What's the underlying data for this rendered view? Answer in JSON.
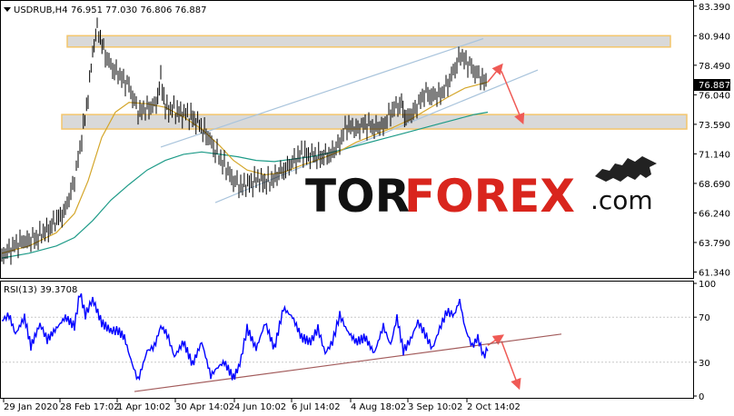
{
  "main_header": {
    "symbol": "USDRUB,H4",
    "ohlc": "76.951 77.030 76.806 76.887"
  },
  "rsi_header": "RSI(13) 39.3708",
  "watermark": {
    "part1": "TOR",
    "part2": "FOREX",
    "suffix": ".com",
    "logo": "bull-icon"
  },
  "colors": {
    "candle": "#000000",
    "ma_fast": "#d4a62a",
    "ma_slow": "#1e9b88",
    "channel": "#a9c4dc",
    "zone_fill": "#d9d9d9",
    "zone_border": "#f3c56b",
    "arrow": "#ef5a55",
    "rsi_line": "#0000ff",
    "rsi_trend": "#a35c5c",
    "price_label_bg": "#000000"
  },
  "chart_data": [
    {
      "type": "candlestick",
      "title": "USDRUB,H4",
      "y_ticks": [
        "83.390",
        "80.940",
        "78.490",
        "76.040",
        "73.590",
        "71.140",
        "68.690",
        "66.240",
        "63.790",
        "61.340"
      ],
      "ylim": [
        61.0,
        83.6
      ],
      "current_price": "76.887",
      "x_labels": [
        "29 Jan 2020",
        "28 Feb 17:02",
        "1 Apr 10:02",
        "30 Apr 14:02",
        "4 Jun 10:02",
        "6 Jul 14:02",
        "4 Aug 18:02",
        "3 Sep 10:02",
        "2 Oct 14:02"
      ],
      "price_path": [
        [
          0,
          62.7
        ],
        [
          20,
          63.8
        ],
        [
          40,
          64.2
        ],
        [
          55,
          65.2
        ],
        [
          70,
          66.5
        ],
        [
          80,
          69.0
        ],
        [
          88,
          72.5
        ],
        [
          95,
          75.8
        ],
        [
          100,
          79.5
        ],
        [
          105,
          81.5
        ],
        [
          112,
          79.8
        ],
        [
          120,
          78.4
        ],
        [
          130,
          77.6
        ],
        [
          140,
          76.8
        ],
        [
          150,
          74.6
        ],
        [
          160,
          74.9
        ],
        [
          170,
          75.3
        ],
        [
          175,
          77.5
        ],
        [
          180,
          75.0
        ],
        [
          195,
          74.6
        ],
        [
          210,
          74.2
        ],
        [
          225,
          72.8
        ],
        [
          235,
          71.4
        ],
        [
          245,
          70.2
        ],
        [
          255,
          68.9
        ],
        [
          265,
          68.4
        ],
        [
          280,
          69.0
        ],
        [
          295,
          68.8
        ],
        [
          305,
          69.5
        ],
        [
          320,
          70.4
        ],
        [
          330,
          71.2
        ],
        [
          345,
          70.9
        ],
        [
          360,
          71.0
        ],
        [
          370,
          71.8
        ],
        [
          380,
          73.5
        ],
        [
          390,
          73.2
        ],
        [
          400,
          73.6
        ],
        [
          410,
          73.3
        ],
        [
          420,
          73.5
        ],
        [
          430,
          74.8
        ],
        [
          440,
          75.3
        ],
        [
          445,
          74.0
        ],
        [
          455,
          74.8
        ],
        [
          465,
          76.2
        ],
        [
          475,
          75.9
        ],
        [
          485,
          76.2
        ],
        [
          495,
          77.6
        ],
        [
          505,
          79.3
        ],
        [
          515,
          78.5
        ],
        [
          525,
          77.6
        ],
        [
          535,
          76.9
        ]
      ],
      "ma_fast_path": [
        [
          0,
          62.9
        ],
        [
          30,
          63.5
        ],
        [
          60,
          64.6
        ],
        [
          80,
          66.2
        ],
        [
          95,
          68.9
        ],
        [
          110,
          72.5
        ],
        [
          125,
          74.6
        ],
        [
          140,
          75.4
        ],
        [
          160,
          75.3
        ],
        [
          180,
          75.0
        ],
        [
          200,
          74.2
        ],
        [
          220,
          73.2
        ],
        [
          240,
          71.8
        ],
        [
          255,
          70.6
        ],
        [
          270,
          69.8
        ],
        [
          290,
          69.4
        ],
        [
          310,
          69.6
        ],
        [
          330,
          70.2
        ],
        [
          350,
          70.7
        ],
        [
          370,
          71.3
        ],
        [
          390,
          72.1
        ],
        [
          410,
          72.7
        ],
        [
          430,
          73.3
        ],
        [
          450,
          74.0
        ],
        [
          470,
          74.9
        ],
        [
          490,
          75.8
        ],
        [
          510,
          76.6
        ],
        [
          535,
          77.1
        ]
      ],
      "ma_slow_path": [
        [
          0,
          62.5
        ],
        [
          30,
          62.9
        ],
        [
          60,
          63.5
        ],
        [
          80,
          64.2
        ],
        [
          100,
          65.6
        ],
        [
          120,
          67.3
        ],
        [
          140,
          68.6
        ],
        [
          160,
          69.8
        ],
        [
          180,
          70.6
        ],
        [
          200,
          71.1
        ],
        [
          220,
          71.3
        ],
        [
          240,
          71.1
        ],
        [
          260,
          70.9
        ],
        [
          280,
          70.6
        ],
        [
          300,
          70.5
        ],
        [
          320,
          70.7
        ],
        [
          340,
          70.9
        ],
        [
          360,
          71.2
        ],
        [
          380,
          71.6
        ],
        [
          400,
          72.0
        ],
        [
          420,
          72.4
        ],
        [
          440,
          72.8
        ],
        [
          460,
          73.2
        ],
        [
          480,
          73.6
        ],
        [
          500,
          74.0
        ],
        [
          520,
          74.4
        ],
        [
          535,
          74.6
        ]
      ],
      "resistance_zone": [
        80.0,
        80.94
      ],
      "support_zone": [
        73.2,
        74.4
      ],
      "channel_lower": [
        [
          237,
          67.1
        ],
        [
          592,
          78.1
        ]
      ],
      "channel_upper": [
        [
          177,
          71.7
        ],
        [
          532,
          80.7
        ]
      ],
      "forecast_arrow": [
        [
          535,
          77.1
        ],
        [
          548,
          78.3
        ],
        [
          572,
          74.0
        ]
      ]
    },
    {
      "type": "line",
      "title": "RSI(13) 39.3708",
      "y_ticks": [
        "100",
        "70",
        "30",
        "0"
      ],
      "ylim": [
        0,
        100
      ],
      "rsi_path": [
        [
          0,
          67
        ],
        [
          8,
          72
        ],
        [
          15,
          55
        ],
        [
          25,
          70
        ],
        [
          32,
          44
        ],
        [
          42,
          64
        ],
        [
          50,
          50
        ],
        [
          60,
          60
        ],
        [
          70,
          70
        ],
        [
          80,
          62
        ],
        [
          86,
          92
        ],
        [
          92,
          72
        ],
        [
          100,
          86
        ],
        [
          110,
          65
        ],
        [
          120,
          58
        ],
        [
          128,
          58
        ],
        [
          135,
          52
        ],
        [
          142,
          32
        ],
        [
          150,
          14
        ],
        [
          160,
          40
        ],
        [
          168,
          44
        ],
        [
          175,
          62
        ],
        [
          182,
          55
        ],
        [
          190,
          35
        ],
        [
          200,
          48
        ],
        [
          210,
          28
        ],
        [
          220,
          48
        ],
        [
          230,
          18
        ],
        [
          238,
          26
        ],
        [
          245,
          30
        ],
        [
          255,
          16
        ],
        [
          262,
          28
        ],
        [
          270,
          60
        ],
        [
          280,
          42
        ],
        [
          290,
          65
        ],
        [
          300,
          42
        ],
        [
          310,
          78
        ],
        [
          320,
          70
        ],
        [
          330,
          52
        ],
        [
          340,
          48
        ],
        [
          348,
          60
        ],
        [
          356,
          38
        ],
        [
          364,
          48
        ],
        [
          372,
          72
        ],
        [
          380,
          58
        ],
        [
          390,
          48
        ],
        [
          400,
          52
        ],
        [
          410,
          38
        ],
        [
          420,
          62
        ],
        [
          428,
          45
        ],
        [
          435,
          70
        ],
        [
          442,
          40
        ],
        [
          450,
          50
        ],
        [
          458,
          66
        ],
        [
          466,
          55
        ],
        [
          474,
          42
        ],
        [
          482,
          60
        ],
        [
          490,
          75
        ],
        [
          498,
          72
        ],
        [
          504,
          85
        ],
        [
          510,
          60
        ],
        [
          518,
          44
        ],
        [
          524,
          52
        ],
        [
          530,
          36
        ],
        [
          535,
          40
        ]
      ],
      "rsi_trendline": [
        [
          148,
          4
        ],
        [
          618,
          55
        ]
      ],
      "rsi_arrow": [
        [
          535,
          45
        ],
        [
          548,
          52
        ],
        [
          568,
          10
        ]
      ]
    }
  ]
}
